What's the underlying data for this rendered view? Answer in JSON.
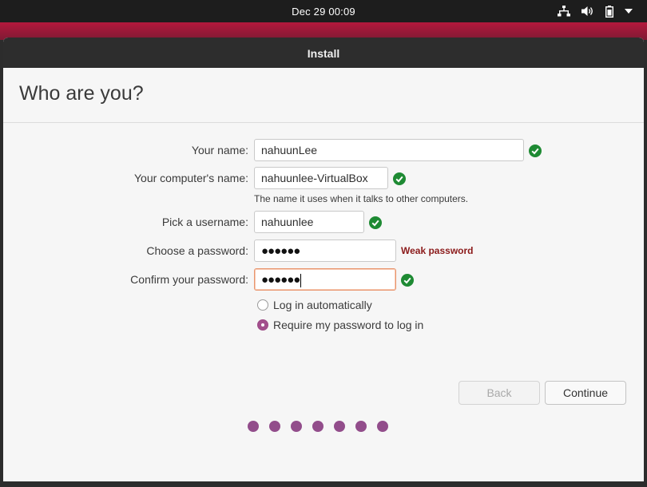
{
  "topbar": {
    "clock": "Dec 29  00:09",
    "icons": [
      "network-icon",
      "volume-icon",
      "battery-icon",
      "system-menu-icon"
    ]
  },
  "window": {
    "title": "Install"
  },
  "page": {
    "heading": "Who are you?"
  },
  "form": {
    "name": {
      "label": "Your name:",
      "value": "nahuunLee",
      "valid": true
    },
    "computer": {
      "label": "Your computer's name:",
      "value": "nahuunlee-VirtualBox",
      "hint": "The name it uses when it talks to other computers.",
      "valid": true
    },
    "username": {
      "label": "Pick a username:",
      "value": "nahuunlee",
      "valid": true
    },
    "password": {
      "label": "Choose a password:",
      "masked": "●●●●●●",
      "strength": "Weak password"
    },
    "confirm": {
      "label": "Confirm your password:",
      "masked": "●●●●●●",
      "valid": true
    }
  },
  "login_options": {
    "auto": {
      "label": "Log in automatically",
      "selected": false
    },
    "require": {
      "label": "Require my password to log in",
      "selected": true
    }
  },
  "buttons": {
    "back": "Back",
    "continue": "Continue"
  },
  "progress": {
    "total_steps": 7
  },
  "colors": {
    "accent": "#924d8b",
    "valid": "#1e8a33",
    "weak": "#8b1a1a",
    "focus_border": "#e9956d"
  }
}
